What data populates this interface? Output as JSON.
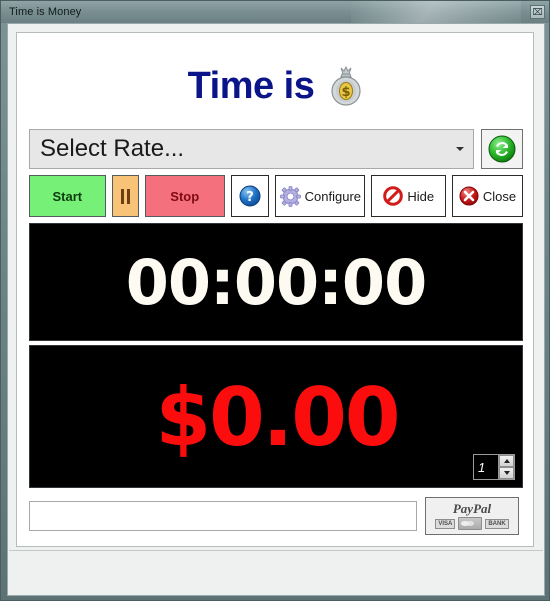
{
  "window": {
    "title": "Time is Money",
    "close_glyph": "⌧"
  },
  "header": {
    "title": "Time is",
    "icon": "money-bag-icon"
  },
  "rate": {
    "selected": "Select Rate...",
    "placeholder": "Select Rate...",
    "options": [
      "Select Rate..."
    ],
    "refresh_icon": "refresh-icon"
  },
  "toolbar": {
    "start_label": "Start",
    "pause_label": "",
    "stop_label": "Stop",
    "help_label": "",
    "configure_label": "Configure",
    "hide_label": "Hide",
    "close_label": "Close"
  },
  "displays": {
    "timer": "00:00:00",
    "money": "$0.00",
    "multiplier": "1"
  },
  "bottom": {
    "note_value": "",
    "note_placeholder": "",
    "paypal_word": "PayPal",
    "card_visa": "VISA",
    "card_bank": "BANK"
  },
  "colors": {
    "title_blue": "#0c1489",
    "start_green": "#77f077",
    "pause_orange": "#f8c377",
    "stop_red": "#f4707c",
    "money_red": "#fc0d0d",
    "timer_white": "#fdfaf2",
    "display_black": "#000000"
  }
}
